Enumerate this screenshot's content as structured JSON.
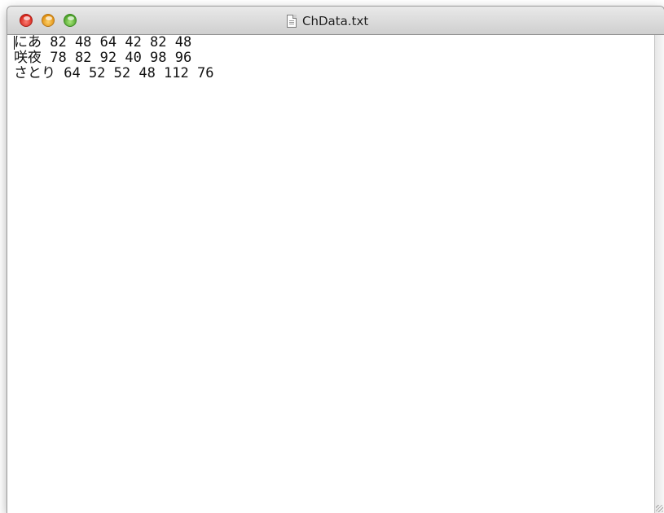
{
  "window": {
    "title": "ChData.txt",
    "title_icon": "text-document-icon",
    "traffic_lights": {
      "close": "#ec4a3f",
      "minimize": "#f5b33d",
      "maximize": "#6cc245"
    }
  },
  "document": {
    "lines": [
      "にあ 82 48 64 42 82 48",
      "咲夜 78 82 92 40 98 96",
      "さとり 64 52 52 48 112 76"
    ]
  }
}
